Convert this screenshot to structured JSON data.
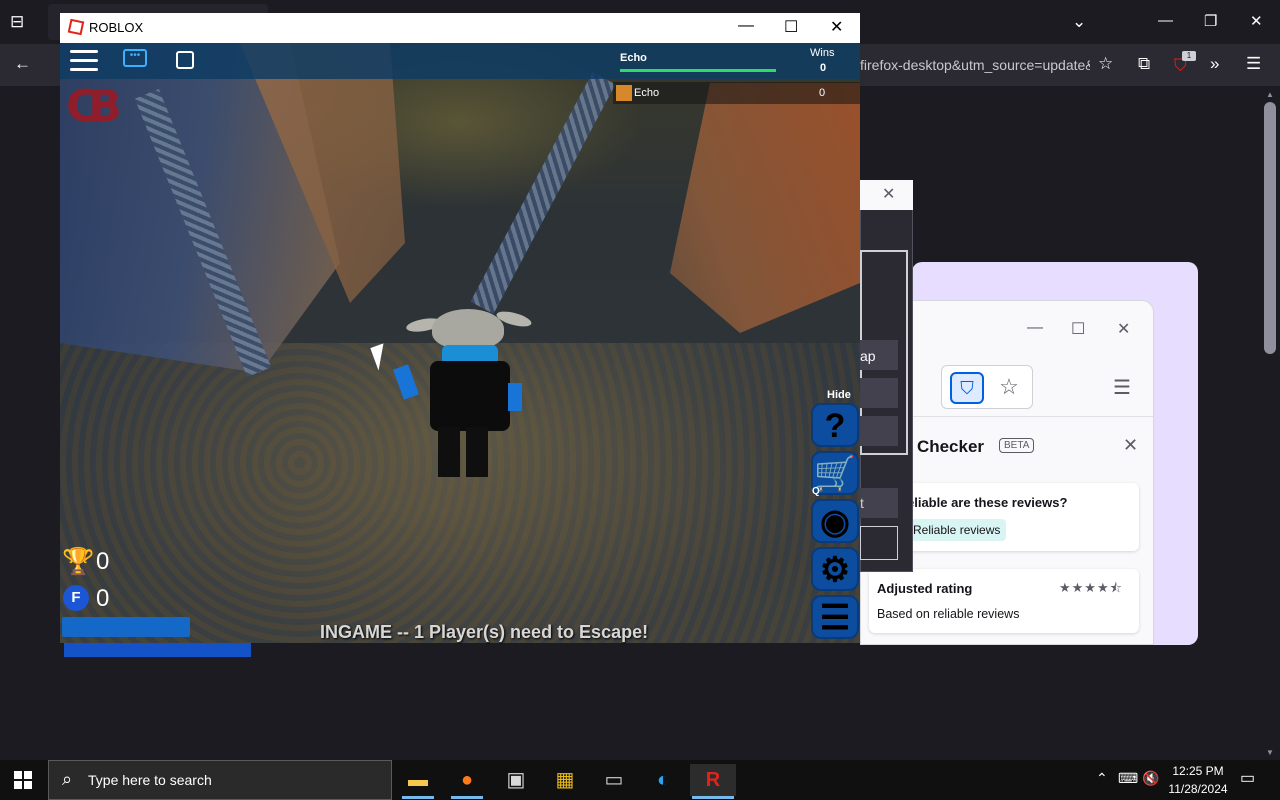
{
  "firefox": {
    "url_fragment": "firefox-desktop&utm_source=update&",
    "ext_badge": "1"
  },
  "promo": {
    "checker_title": "w Checker",
    "beta": "BETA",
    "card1_question": "eliable are these reviews?",
    "card1_pill": "Reliable reviews",
    "card2_heading": "Adjusted rating",
    "card2_sub": "Based on reliable reviews",
    "card2_stars": "★★★★⯪"
  },
  "dialog": {
    "ap_text": "ap",
    "t_text": "t"
  },
  "roblox": {
    "window_title": "ROBLOX",
    "leaderboard": {
      "player_name": "Echo",
      "wins_label": "Wins",
      "wins_value": "0",
      "row_name": "Echo",
      "row_value": "0"
    },
    "stats": {
      "trophies": "0",
      "coins": "0"
    },
    "hide_label": "Hide",
    "q_label": "Q",
    "status": "INGAME -- 1 Player(s) need to Escape!",
    "side_buttons": [
      "?",
      "🛒",
      "◉",
      "⚙",
      "☰"
    ]
  },
  "taskbar": {
    "search_placeholder": "Type here to search",
    "time": "12:25 PM",
    "date": "11/28/2024"
  }
}
